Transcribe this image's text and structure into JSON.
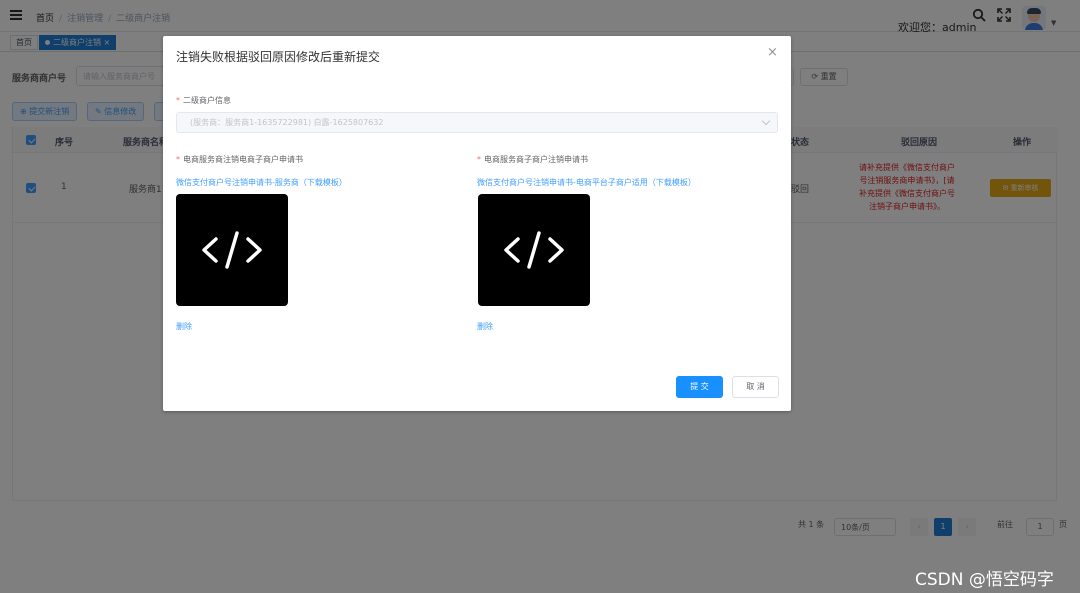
{
  "header": {
    "breadcrumb": [
      "首页",
      "注销管理",
      "二级商户注销"
    ],
    "welcome": "欢迎您：admin"
  },
  "tags": [
    "首页",
    "二级商户注销"
  ],
  "filter": {
    "label": "服务商商户号",
    "placeholder": "请输入服务商商户号",
    "reset_label": "重置"
  },
  "actions": {
    "submit_new": "提交新注销",
    "edit_info": "信息修改"
  },
  "table": {
    "headers": [
      "序号",
      "服务商名称",
      "状态",
      "驳回原因",
      "操作"
    ],
    "rows": [
      {
        "index": "1",
        "provider": "服务商1",
        "status": "驳回",
        "reject_reason": "请补充提供《微信支付商户号注销服务商申请书》，[请补充提供《微信支付商户号注销子商户申请书》。",
        "action": "重新审核"
      }
    ]
  },
  "pager": {
    "total": "共 1 条",
    "page_size": "10条/页",
    "current": "1",
    "goto_label": "前往",
    "goto_value": "1",
    "page_unit": "页"
  },
  "dialog": {
    "title": "注销失败根据驳回原因修改后重新提交",
    "close": "×",
    "merchant_label": "二级商户信息",
    "merchant_value": "(服务商：服务商1-1635722981) 白露-1625807632",
    "left_label": "电商服务商注销电商子商户申请书",
    "left_link": "微信支付商户号注销申请书-服务商（下载模板）",
    "left_delete": "删除",
    "right_label": "电商服务商子商户注销申请书",
    "right_link": "微信支付商户号注销申请书-电商平台子商户适用（下载模板）",
    "right_delete": "删除",
    "submit": "提 交",
    "cancel": "取 消",
    "thumb_icon": "code-icon"
  },
  "watermark": "CSDN @悟空码字",
  "colors": {
    "primary": "#1890ff",
    "tag_active": "#1f7fd4",
    "danger": "#e02020",
    "warning": "#e6a817"
  }
}
